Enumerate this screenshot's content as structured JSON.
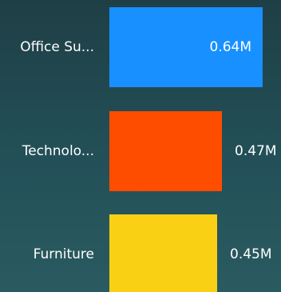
{
  "chart_data": {
    "type": "bar",
    "orientation": "horizontal",
    "categories": [
      "Office Su...",
      "Technolo...",
      "Furniture"
    ],
    "values": [
      0.64,
      0.47,
      0.45
    ],
    "value_labels": [
      "0.64M",
      "0.47M",
      "0.45M"
    ],
    "colors": [
      "#1890ff",
      "#ff4d00",
      "#fad015"
    ],
    "xlim": [
      0,
      0.7
    ],
    "grid": false,
    "legend": "none"
  }
}
